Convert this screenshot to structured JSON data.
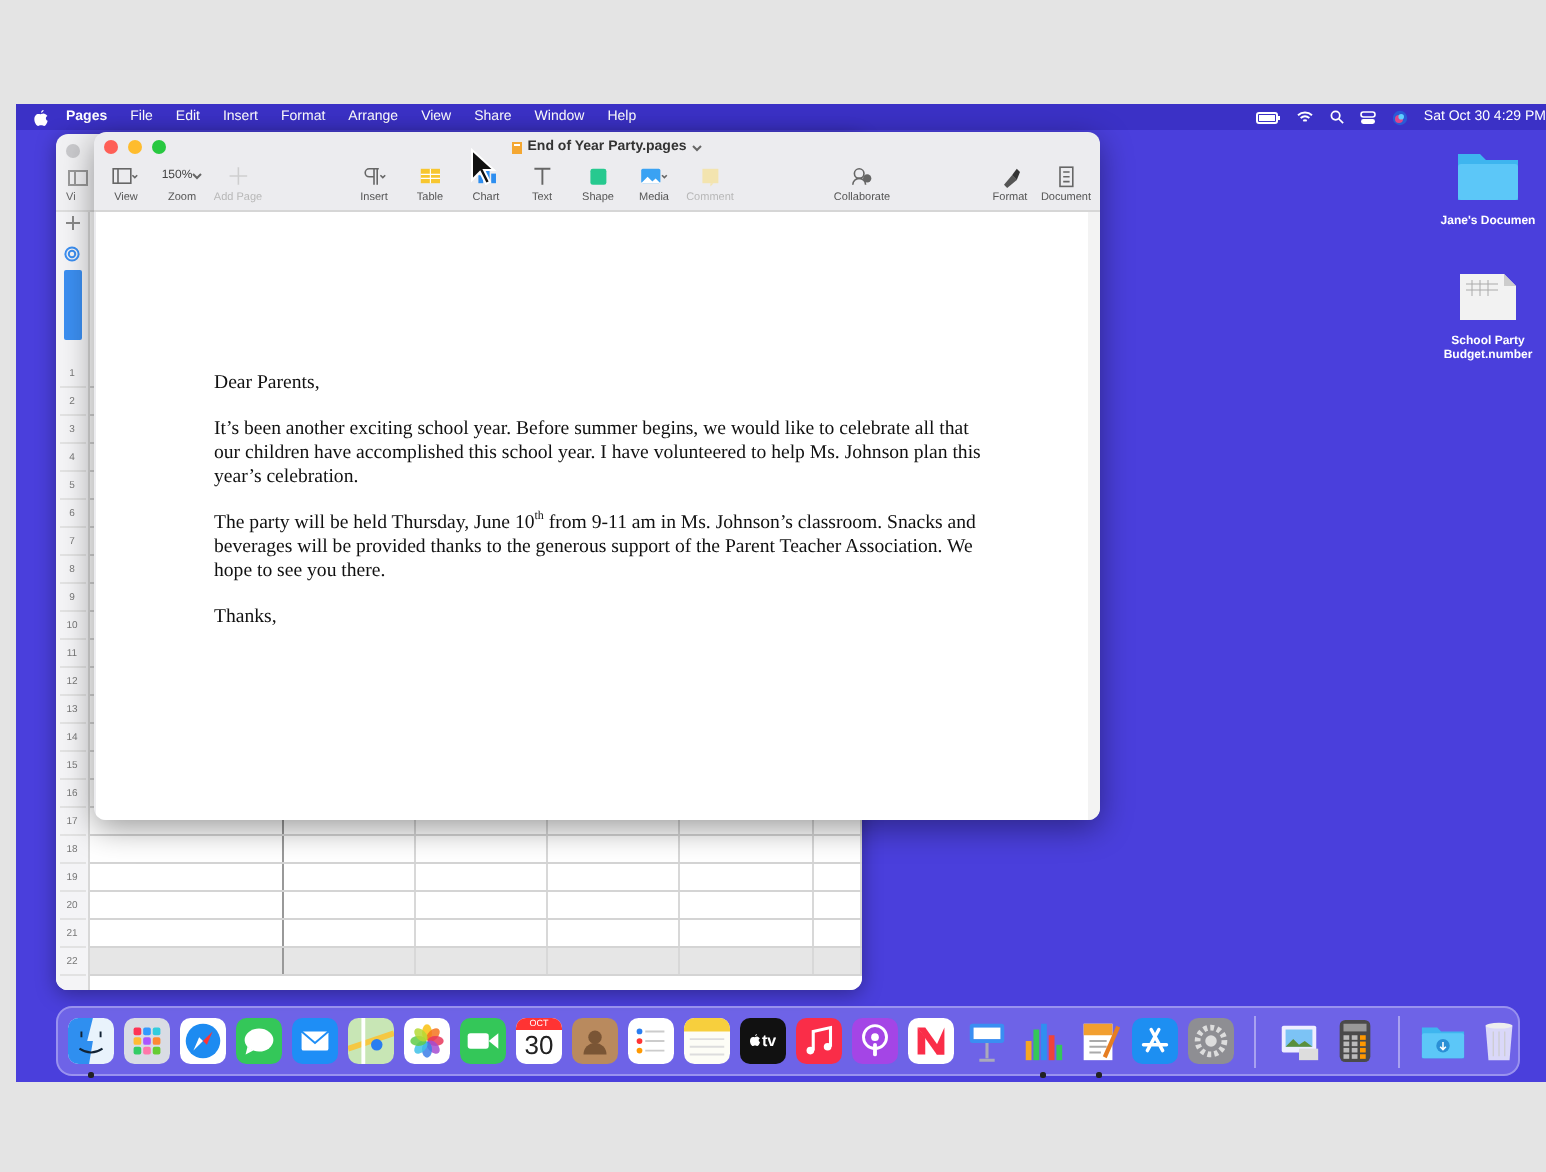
{
  "menu_bar": {
    "app_name": "Pages",
    "menus": [
      "File",
      "Edit",
      "Insert",
      "Format",
      "Arrange",
      "View",
      "Share",
      "Window",
      "Help"
    ],
    "clock": "Sat Oct 30 4:29 PM"
  },
  "numbers_window": {
    "toolbar_label": "Vi",
    "rows": [
      {
        "number": "1",
        "kind": "body"
      },
      {
        "number": "2",
        "kind": "body"
      },
      {
        "number": "3",
        "kind": "body"
      },
      {
        "number": "4",
        "kind": "body"
      },
      {
        "number": "5",
        "kind": "body"
      },
      {
        "number": "6",
        "kind": "body"
      },
      {
        "number": "7",
        "kind": "body"
      },
      {
        "number": "8",
        "kind": "body"
      },
      {
        "number": "9",
        "kind": "body"
      },
      {
        "number": "10",
        "kind": "body"
      },
      {
        "number": "11",
        "kind": "body"
      },
      {
        "number": "12",
        "kind": "body"
      },
      {
        "number": "13",
        "kind": "body"
      },
      {
        "number": "14",
        "kind": "body"
      },
      {
        "number": "15",
        "kind": "body"
      },
      {
        "number": "16",
        "kind": "body"
      },
      {
        "number": "17",
        "kind": "body"
      },
      {
        "number": "18",
        "kind": "body"
      },
      {
        "number": "19",
        "kind": "body"
      },
      {
        "number": "20",
        "kind": "body"
      },
      {
        "number": "21",
        "kind": "body"
      },
      {
        "number": "22",
        "kind": "footer"
      }
    ]
  },
  "pages_window": {
    "title": "End of Year Party.pages",
    "toolbar": [
      {
        "kind": "view",
        "label": "View",
        "disabled": false
      },
      {
        "kind": "zoom",
        "label": "Zoom",
        "value": "150%",
        "disabled": false
      },
      {
        "kind": "add_page",
        "label": "Add Page",
        "disabled": true
      },
      {
        "kind": "insert",
        "label": "Insert",
        "disabled": false
      },
      {
        "kind": "table",
        "label": "Table",
        "disabled": false
      },
      {
        "kind": "chart",
        "label": "Chart",
        "disabled": false
      },
      {
        "kind": "text",
        "label": "Text",
        "disabled": false
      },
      {
        "kind": "shape",
        "label": "Shape",
        "disabled": false
      },
      {
        "kind": "media",
        "label": "Media",
        "disabled": false
      },
      {
        "kind": "comment",
        "label": "Comment",
        "disabled": true
      },
      {
        "kind": "collaborate",
        "label": "Collaborate",
        "disabled": false
      },
      {
        "kind": "format",
        "label": "Format",
        "disabled": false
      },
      {
        "kind": "document",
        "label": "Document",
        "disabled": false
      }
    ],
    "document": {
      "paragraphs": [
        "Dear Parents,",
        "It’s been another exciting school year. Before summer begins, we would like to celebrate all that our children have accomplished this school year. I have volunteered to help Ms. Johnson plan this year’s celebration.",
        "The party will be held Thursday, June 10$^{th}$ from 9-11 am in Ms. Johnson’s classroom. Snacks and beverages will be provided thanks to the generous support of the Parent Teacher Association. We hope to see you there.",
        "Thanks,"
      ]
    }
  },
  "desktop_icons": [
    {
      "kind": "folder",
      "label": "Jane's Documen"
    },
    {
      "kind": "spreadsheet",
      "label": "School Party Budget.number"
    }
  ],
  "dock": {
    "items": [
      {
        "kind": "finder",
        "running": true
      },
      {
        "kind": "launchpad",
        "running": false
      },
      {
        "kind": "safari",
        "running": false
      },
      {
        "kind": "messages",
        "running": false
      },
      {
        "kind": "mail",
        "running": false
      },
      {
        "kind": "maps",
        "running": false
      },
      {
        "kind": "photos",
        "running": false
      },
      {
        "kind": "facetime",
        "running": false
      },
      {
        "kind": "calendar",
        "month": "OCT",
        "day": "30",
        "running": false
      },
      {
        "kind": "contacts",
        "running": false
      },
      {
        "kind": "reminders",
        "running": false
      },
      {
        "kind": "notes",
        "running": false
      },
      {
        "kind": "tv",
        "label": "tv",
        "running": false
      },
      {
        "kind": "music",
        "running": false
      },
      {
        "kind": "podcasts",
        "running": false
      },
      {
        "kind": "news",
        "running": false
      },
      {
        "kind": "keynote",
        "running": false
      },
      {
        "kind": "numbers",
        "running": true
      },
      {
        "kind": "pages",
        "running": true
      },
      {
        "kind": "appstore",
        "running": false
      },
      {
        "kind": "settings",
        "running": false
      },
      {
        "kind": "separator"
      },
      {
        "kind": "preview",
        "running": false
      },
      {
        "kind": "calculator",
        "running": false
      },
      {
        "kind": "separator"
      },
      {
        "kind": "downloads",
        "running": false
      },
      {
        "kind": "trash",
        "running": false
      }
    ]
  }
}
